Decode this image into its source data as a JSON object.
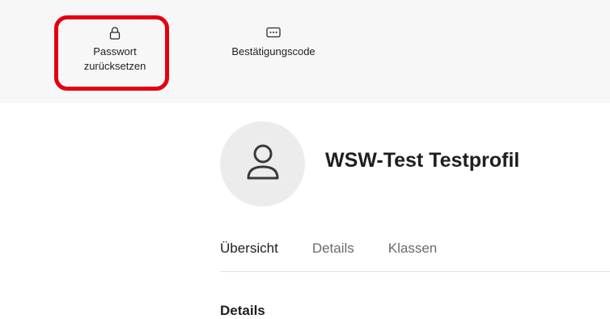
{
  "toolbar": {
    "reset_password": {
      "label_line1": "Passwort",
      "label_line2": "zurücksetzen",
      "icon": "lock-icon"
    },
    "confirmation_code": {
      "label": "Bestätigungscode",
      "icon": "dots-box-icon"
    },
    "highlight_color": "#e3000f"
  },
  "profile": {
    "name": "WSW-Test Testprofil",
    "avatar_icon": "user-icon"
  },
  "tabs": [
    {
      "label": "Übersicht",
      "active": true
    },
    {
      "label": "Details",
      "active": false
    },
    {
      "label": "Klassen",
      "active": false
    }
  ],
  "section": {
    "heading": "Details"
  }
}
